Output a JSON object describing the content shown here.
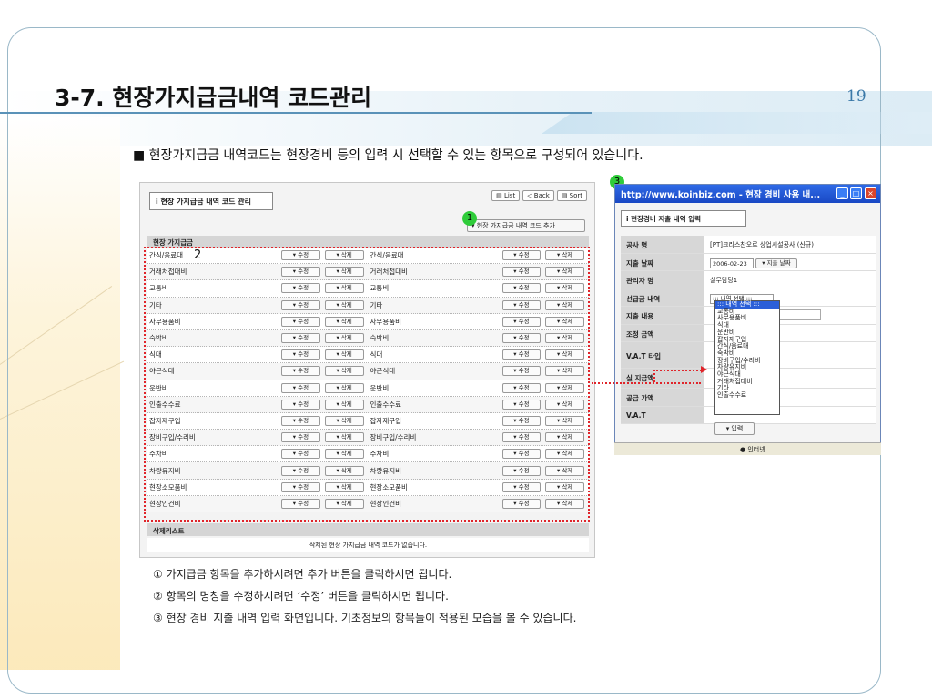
{
  "slide": {
    "title": "3-7. 현장가지급금내역 코드관리",
    "page": "19",
    "intro": "■ 현장가지급금 내역코드는 현장경비 등의 입력 시 선택할 수 있는 항목으로 구성되어 있습니다."
  },
  "main_screen": {
    "tab_title": "ⅰ 현장 가지급금 내역 코드 관리",
    "top_buttons": [
      "▤ List",
      "◁ Back",
      "▤ Sort"
    ],
    "add_button": "▾ 현장 가지급금 내역 코드 추가",
    "section_header": "현장 가지급금",
    "edit_label": "▾ 수정",
    "delete_label": "▾ 삭제",
    "items": [
      "간식/음료대",
      "거래처접대비",
      "교통비",
      "기타",
      "사무용품비",
      "숙박비",
      "식대",
      "야근식대",
      "운반비",
      "인출수수료",
      "잡자재구입",
      "장비구입/수리비",
      "주차비",
      "차량유지비",
      "현장소모품비",
      "현장인건비"
    ],
    "deleted_header": "삭제리스트",
    "deleted_message": "삭제된 현장 가지급금 내역 코드가 없습니다."
  },
  "badges": {
    "one": "1",
    "two": "2",
    "three": "3"
  },
  "popup": {
    "title": "http://www.koinbiz.com - 현장 경비 사용 내...",
    "tab_title": "ⅰ 현장경비 지출 내역 입력",
    "fields": [
      {
        "label": "공사 명",
        "value": "[PT]크리스찬오로 상업시설공사 (신규)"
      },
      {
        "label": "지출 날짜",
        "date": "2006-02-23",
        "button": "▾ 지출 날짜"
      },
      {
        "label": "관리자 명",
        "value": "실무담당1"
      },
      {
        "label": "선급금 내역",
        "select": "::: 내역 선택 :::"
      },
      {
        "label": "지출 내용",
        "value": ""
      },
      {
        "label": "조정 금액",
        "value": ""
      },
      {
        "label": "V.A.T 타입",
        "value": ""
      },
      {
        "label": "실 지급액",
        "value": ""
      },
      {
        "label": "공급 가액",
        "value": ""
      },
      {
        "label": "V.A.T",
        "value": ""
      }
    ],
    "dropdown": [
      "::: 내역 선택 :::",
      "교통비",
      "사무용품비",
      "식대",
      "운반비",
      "잡자재구입",
      "간식/음료대",
      "숙박비",
      "장비구입/수리비",
      "차량유지비",
      "야근식대",
      "거래처접대비",
      "기타",
      "인출수수료"
    ],
    "submit": "▾ 입력",
    "status_zone": "● 인터넷"
  },
  "notes": [
    "① 가지급금 항목을 추가하시려면 추가 버튼을 클릭하시면 됩니다.",
    "② 항목의 명칭을 수정하시려면 ‘수정’ 버튼을 클릭하시면 됩니다.",
    "③ 현장 경비 지출 내역 입력 화면입니다. 기초정보의 항목들이 적용된 모습을 볼 수 있습니다."
  ],
  "colors": {
    "accent": "#e0242a",
    "badge": "#2fcc3a",
    "titlebar": "#2f6ae6"
  }
}
